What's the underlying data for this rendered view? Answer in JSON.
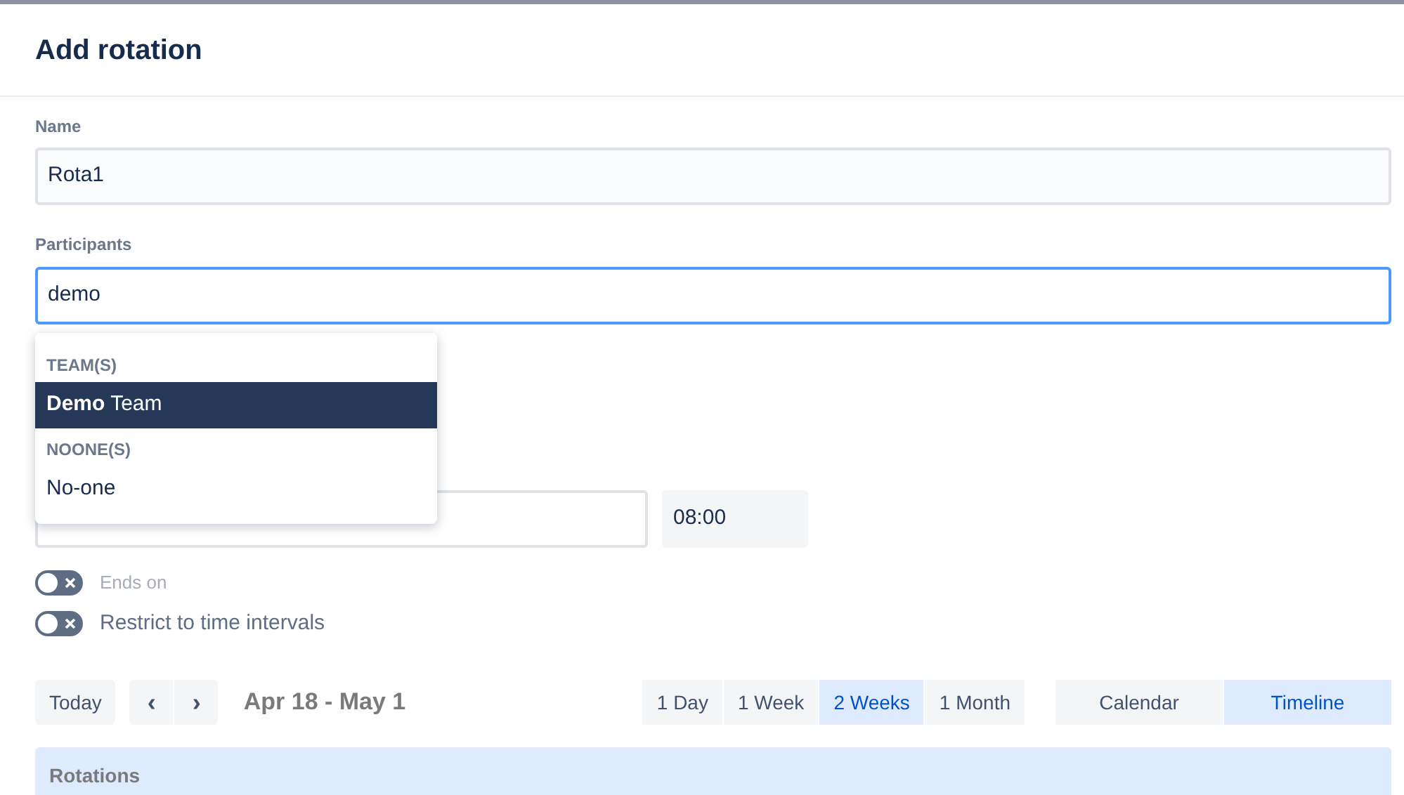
{
  "dialog": {
    "title": "Add rotation"
  },
  "name_field": {
    "label": "Name",
    "value": "Rota1"
  },
  "participants_field": {
    "label": "Participants",
    "value": "demo",
    "focused": true
  },
  "dropdown": {
    "groups": [
      {
        "heading": "TEAM(S)",
        "options": [
          {
            "label": "**Demo** Team",
            "selected": true
          }
        ]
      },
      {
        "heading": "NOONE(S)",
        "options": [
          {
            "label": "No-one",
            "selected": false
          }
        ]
      }
    ]
  },
  "start_time": {
    "value": "08:00"
  },
  "toggles": [
    {
      "label": "Ends on",
      "on": false,
      "disabled": true
    },
    {
      "label": "Restrict to time intervals",
      "on": false,
      "disabled": false
    }
  ],
  "toolbar": {
    "today": "Today",
    "prev": "‹",
    "next": "›",
    "range": "Apr 18 - May 1",
    "periods": [
      {
        "label": "1 Day",
        "selected": false
      },
      {
        "label": "1 Week",
        "selected": false
      },
      {
        "label": "2 Weeks",
        "selected": true
      },
      {
        "label": "1 Month",
        "selected": false
      }
    ],
    "views": [
      {
        "label": "Calendar",
        "selected": false
      },
      {
        "label": "Timeline",
        "selected": true
      }
    ]
  },
  "rotations_header": "Rotations"
}
